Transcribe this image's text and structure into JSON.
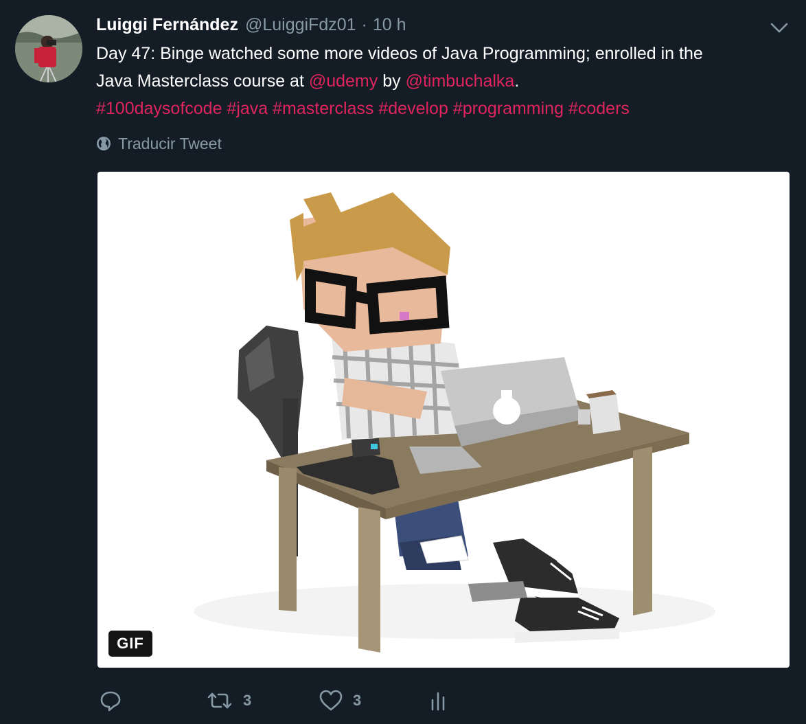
{
  "tweet": {
    "author_name": "Luiggi Fernández",
    "handle": "@LuiggiFdz01",
    "separator": "·",
    "time": "10 h",
    "text": {
      "line1": "Day 47: Binge watched some more videos of Java Programming; enrolled in the",
      "line2_prefix": "Java Masterclass course at ",
      "mention_udemy": "@udemy",
      "line2_mid": " by ",
      "mention_tim": "@timbuchalka",
      "line2_end": ".",
      "hashtags": [
        "#100daysofcode",
        "#java",
        "#masterclass",
        "#develop",
        "#programming",
        "#coders"
      ]
    },
    "translate_label": "Traducir Tweet",
    "media": {
      "badge": "GIF"
    },
    "actions": {
      "reply_count": "",
      "retweet_count": "3",
      "like_count": "3"
    }
  },
  "colors": {
    "background": "#141d26",
    "link": "#e0245e",
    "muted": "#8899a6",
    "text": "#ffffff"
  },
  "icons": [
    "caret-down-icon",
    "globe-icon",
    "reply-icon",
    "retweet-icon",
    "heart-icon",
    "analytics-icon"
  ]
}
